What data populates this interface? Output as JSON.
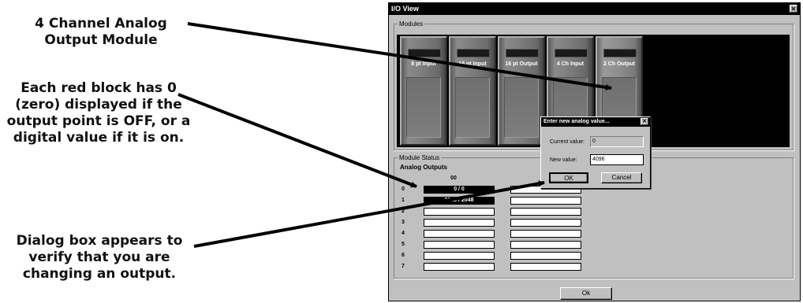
{
  "annotations": {
    "module_callout": "4 Channel Analog Output Module",
    "red_block_callout": "Each red block has 0 (zero) displayed if the output point is OFF, or a digital value if it is on.",
    "dialog_callout": "Dialog box appears to verify that you are changing an output."
  },
  "window": {
    "title": "I/O View",
    "close_glyph": "✕"
  },
  "modules": {
    "group_label": "Modules",
    "slots": [
      {
        "name": "8 pt Input"
      },
      {
        "name": "16 pt Input"
      },
      {
        "name": "16 pt Output"
      },
      {
        "name": "4 Ch Input"
      },
      {
        "name": "2 Ch Output"
      }
    ]
  },
  "module_status": {
    "group_label": "Module Status",
    "title": "Analog Outputs",
    "column_header": "00",
    "rows": [
      {
        "label": "0",
        "value": "0 / 0"
      },
      {
        "label": "1",
        "value": "2048 / 2048"
      },
      {
        "label": "2",
        "value": ""
      },
      {
        "label": "3",
        "value": ""
      },
      {
        "label": "4",
        "value": ""
      },
      {
        "label": "5",
        "value": ""
      },
      {
        "label": "6",
        "value": ""
      },
      {
        "label": "7",
        "value": ""
      }
    ]
  },
  "ok_button": "Ok",
  "dialog": {
    "title": "Enter new analog value...",
    "close_glyph": "✕",
    "current_label": "Current value:",
    "current_value": "0",
    "new_label": "New value:",
    "new_value": "4096",
    "ok": "OK",
    "cancel": "Cancel"
  }
}
